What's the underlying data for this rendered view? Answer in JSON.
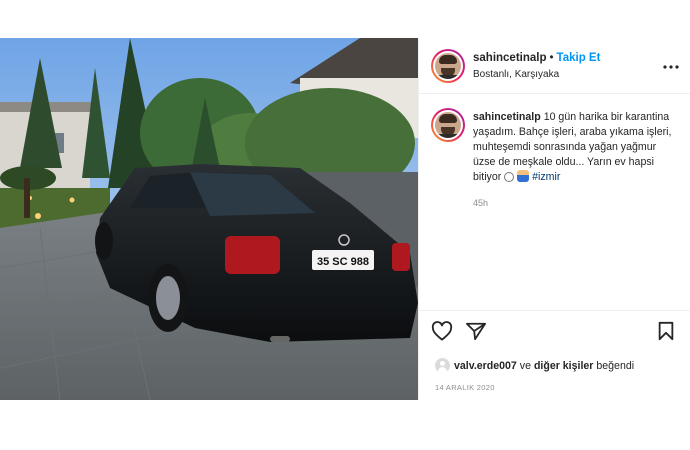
{
  "post": {
    "photo_alt": "",
    "header": {
      "username": "sahincetinalp",
      "separator": "•",
      "follow_label": "Takip Et",
      "location": "Bostanlı, Karşıyaka",
      "more_icon": "more-horizontal-icon"
    },
    "caption": {
      "username": "sahincetinalp",
      "text": "10 gün harika bir karantina yaşadım. Bahçe işleri, araba yıkama işleri, muhteşemdi sonrasında yağan yağmur üzse de meşkale oldu... Yarın ev hapsi bitiyor",
      "hashtag": "#izmir",
      "time_ago": "45h"
    },
    "actions": {
      "like_icon": "heart-icon",
      "share_icon": "paper-plane-icon",
      "save_icon": "bookmark-icon"
    },
    "likes": {
      "liker": "valv.erde007",
      "middle": "ve",
      "others": "diğer kişiler",
      "suffix": "beğendi"
    },
    "date": "14 ARALIK 2020"
  },
  "colors": {
    "follow": "#0095f6",
    "hashtag": "#00376b",
    "muted": "#8e8e8e",
    "border": "#efefef"
  }
}
